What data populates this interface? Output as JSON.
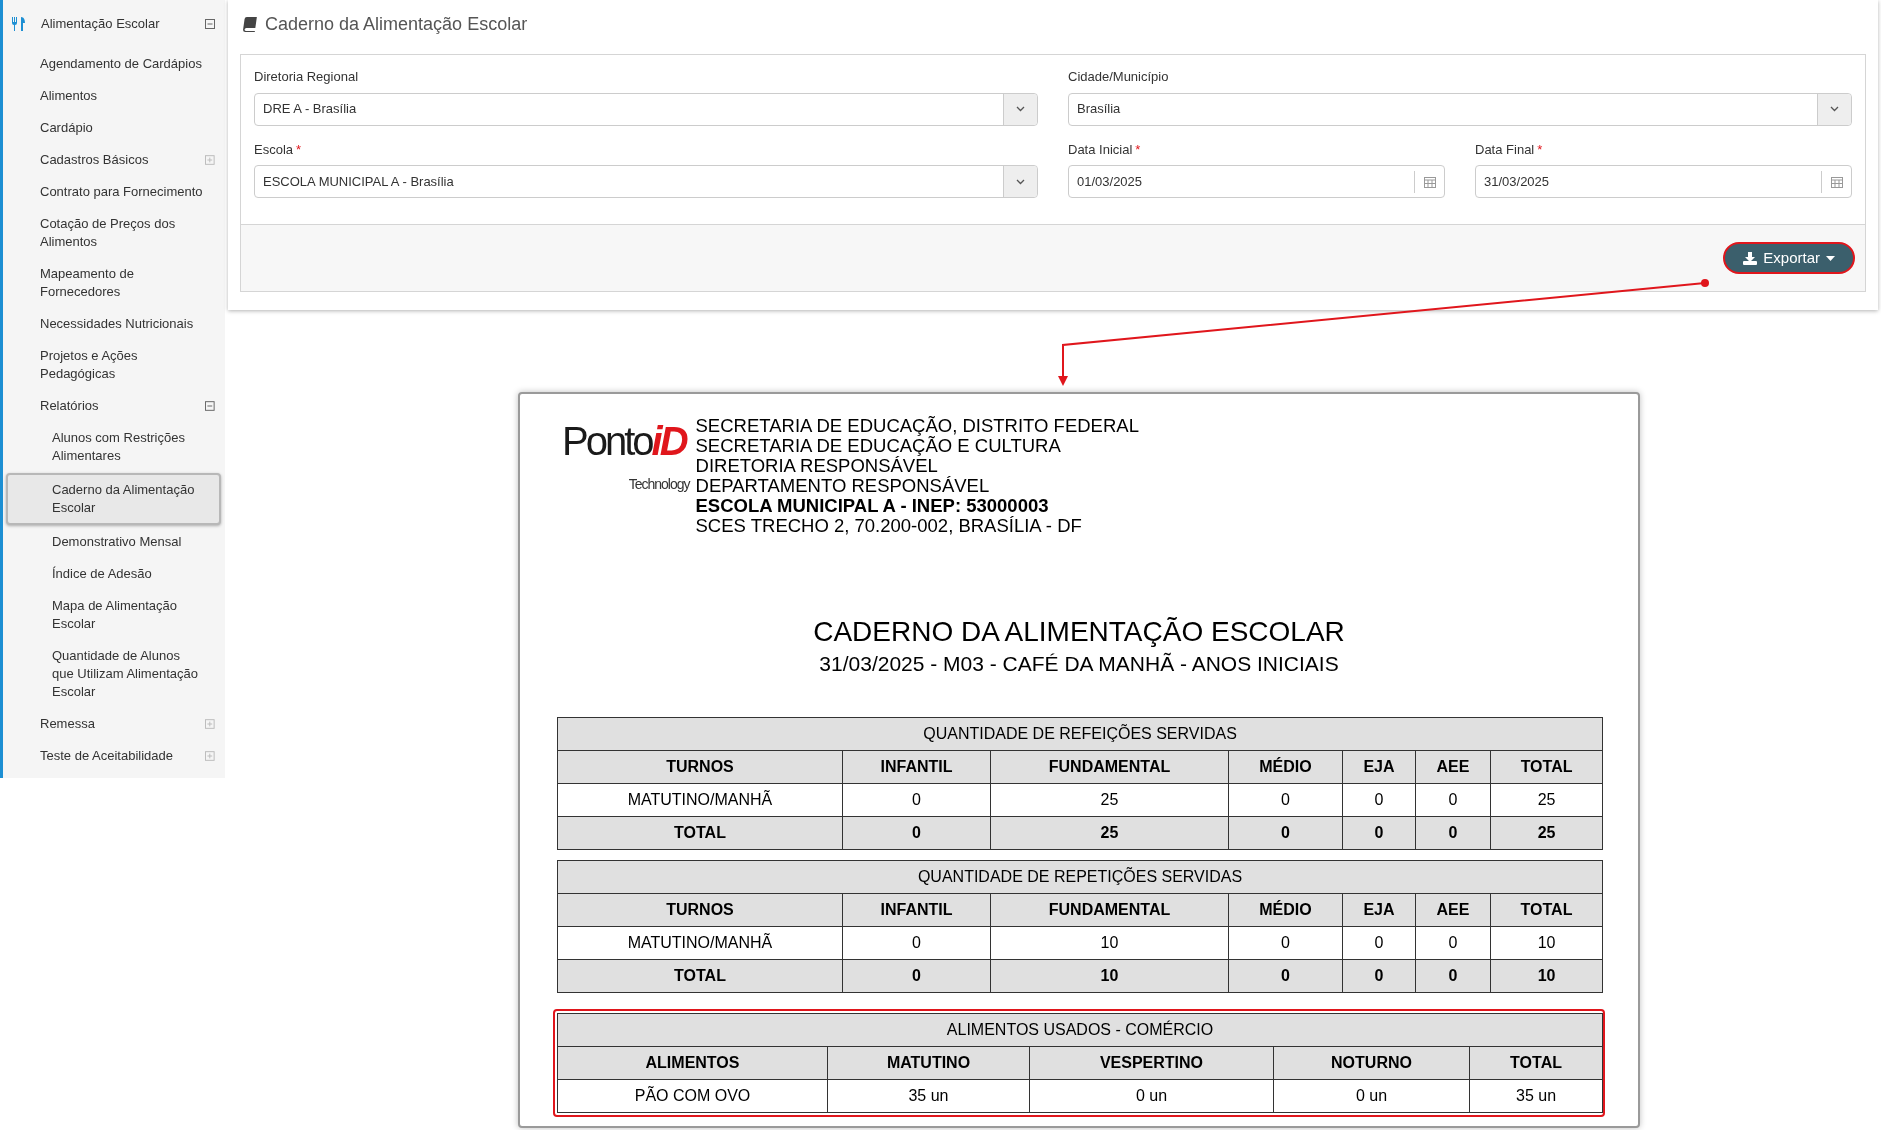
{
  "sidebar": {
    "header": {
      "label": "Alimentação Escolar",
      "expanded": true
    },
    "items": [
      {
        "kind": "link",
        "label": "Agendamento de Cardápios",
        "selected": false
      },
      {
        "kind": "link",
        "label": "Alimentos",
        "selected": false
      },
      {
        "kind": "link",
        "label": "Cardápio",
        "selected": false
      },
      {
        "kind": "group",
        "label": "Cadastros Básicos",
        "selected": false,
        "expanded": false
      },
      {
        "kind": "link",
        "label": "Contrato para Fornecimento",
        "selected": false
      },
      {
        "kind": "link",
        "label": "Cotação de Preços dos Alimentos",
        "selected": false
      },
      {
        "kind": "link",
        "label": "Mapeamento de Fornecedores",
        "selected": false
      },
      {
        "kind": "link",
        "label": "Necessidades Nutricionais",
        "selected": false
      },
      {
        "kind": "link",
        "label": "Projetos e Ações Pedagógicas",
        "selected": false
      },
      {
        "kind": "group",
        "label": "Relatórios",
        "selected": false,
        "expanded": true,
        "children": [
          {
            "label": "Alunos com Restrições Alimentares",
            "selected": false
          },
          {
            "label": "Caderno da Alimentação Escolar",
            "selected": true
          },
          {
            "label": "Demonstrativo Mensal",
            "selected": false
          },
          {
            "label": "Índice de Adesão",
            "selected": false
          },
          {
            "label": "Mapa de Alimentação Escolar",
            "selected": false
          },
          {
            "label": "Quantidade de Alunos que Utilizam Alimentação Escolar",
            "selected": false
          }
        ]
      },
      {
        "kind": "group",
        "label": "Remessa",
        "selected": false,
        "expanded": false
      },
      {
        "kind": "group",
        "label": "Teste de Aceitabilidade",
        "selected": false,
        "expanded": false
      }
    ]
  },
  "page": {
    "title": "Caderno da Alimentação Escolar"
  },
  "form": {
    "fields": [
      {
        "kind": "select",
        "label": "Diretoria Regional",
        "value": "DRE A - Brasília"
      },
      {
        "kind": "select",
        "label": "Cidade/Município",
        "value": "Brasília"
      },
      {
        "kind": "select",
        "label": "Escola",
        "required_mark": "*",
        "value": "ESCOLA MUNICIPAL A - Brasília"
      },
      {
        "kind": "date",
        "label": "Data Inicial",
        "required_mark": "*",
        "value": "01/03/2025"
      },
      {
        "kind": "date",
        "label": "Data Final",
        "required_mark": "*",
        "value": "31/03/2025"
      }
    ],
    "export_button": {
      "label": "Exportar"
    }
  },
  "report": {
    "logo": {
      "word": "Ponto",
      "accent": "iD",
      "tagline": "Technology"
    },
    "header_lines": [
      {
        "text": "SECRETARIA DE EDUCAÇÃO, DISTRITO FEDERAL",
        "bold": false
      },
      {
        "text": "SECRETARIA DE EDUCAÇÃO E CULTURA",
        "bold": false
      },
      {
        "text": "DIRETORIA RESPONSÁVEL",
        "bold": false
      },
      {
        "text": "DEPARTAMENTO RESPONSÁVEL",
        "bold": false
      },
      {
        "text": "ESCOLA MUNICIPAL A - INEP: 53000003",
        "bold": true
      },
      {
        "text": "SCES TRECHO 2, 70.200-002, BRASÍLIA - DF",
        "bold": false
      }
    ],
    "title": "CADERNO DA ALIMENTAÇÃO ESCOLAR",
    "subtitle": "31/03/2025 - M03 - CAFÉ DA MANHÃ - ANOS INICIAIS",
    "tables": [
      {
        "title": "QUANTIDADE DE REFEIÇÕES SERVIDAS",
        "highlighted": false,
        "columns": [
          "TURNOS",
          "INFANTIL",
          "FUNDAMENTAL",
          "MÉDIO",
          "EJA",
          "AEE",
          "TOTAL"
        ],
        "rows": [
          {
            "kind": "data",
            "cells": [
              "MATUTINO/MANHÃ",
              "0",
              "25",
              "0",
              "0",
              "0",
              "25"
            ]
          },
          {
            "kind": "total",
            "cells": [
              "TOTAL",
              "0",
              "25",
              "0",
              "0",
              "0",
              "25"
            ]
          }
        ]
      },
      {
        "title": "QUANTIDADE DE REPETIÇÕES SERVIDAS",
        "highlighted": false,
        "columns": [
          "TURNOS",
          "INFANTIL",
          "FUNDAMENTAL",
          "MÉDIO",
          "EJA",
          "AEE",
          "TOTAL"
        ],
        "rows": [
          {
            "kind": "data",
            "cells": [
              "MATUTINO/MANHÃ",
              "0",
              "10",
              "0",
              "0",
              "0",
              "10"
            ]
          },
          {
            "kind": "total",
            "cells": [
              "TOTAL",
              "0",
              "10",
              "0",
              "0",
              "0",
              "10"
            ]
          }
        ]
      },
      {
        "title": "ALIMENTOS USADOS - COMÉRCIO",
        "highlighted": true,
        "columns": [
          "ALIMENTOS",
          "MATUTINO",
          "VESPERTINO",
          "NOTURNO",
          "TOTAL"
        ],
        "rows": [
          {
            "kind": "data",
            "cells": [
              "PÃO COM OVO",
              "35 un",
              "0 un",
              "0 un",
              "35 un"
            ]
          }
        ]
      }
    ]
  }
}
